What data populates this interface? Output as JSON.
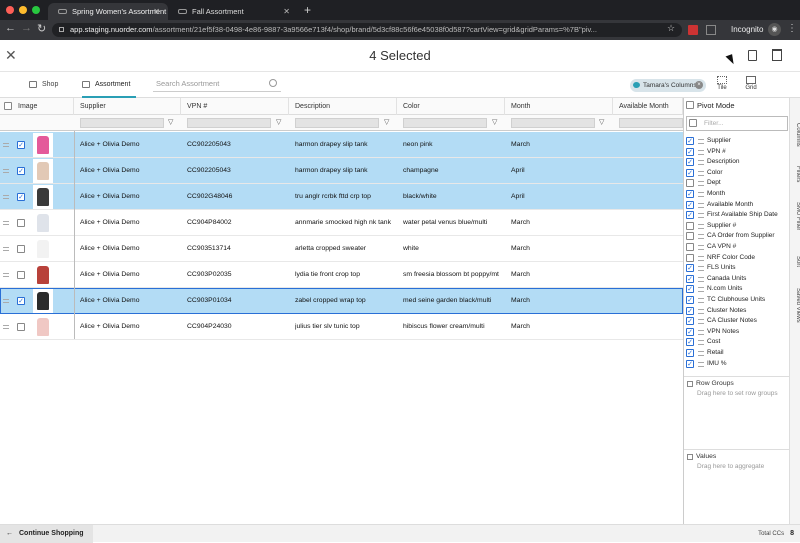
{
  "browser": {
    "tabs": [
      {
        "label": "Spring Women's Assortment",
        "close": "✕"
      },
      {
        "label": "Fall Assortment",
        "close": "✕"
      }
    ],
    "new_tab": "+",
    "url_host": "app.staging.nuorder.com",
    "url_path": "/assortment/21ef5f38-0498-4e86-9887-3a9566e713f4/shop/brand/5d3cf88c56f6e45038f0d587?cartView=grid&gridParams=%7B\"piv...",
    "incognito_label": "Incognito"
  },
  "header": {
    "close": "✕",
    "title": "4 Selected"
  },
  "toolbar": {
    "shop_label": "Shop",
    "assortment_label": "Assortment",
    "search_placeholder": "Search Assortment",
    "chip_label": "Tamara's Columns",
    "chip_close": "×",
    "tile_label": "Tile",
    "grid_label": "Grid"
  },
  "grid": {
    "columns": [
      "Image",
      "Supplier",
      "VPN #",
      "Description",
      "Color",
      "Month",
      "Available Month"
    ],
    "filter_icon": "▽",
    "check_mark": "✓",
    "rows": [
      {
        "supplier": "Alice + Olivia Demo",
        "vpn": "CC902205043",
        "description": "harmon drapey slip tank",
        "color": "neon pink",
        "month": "March",
        "selected": true,
        "thumb": "#e45a9a"
      },
      {
        "supplier": "Alice + Olivia Demo",
        "vpn": "CC902205043",
        "description": "harmon drapey slip tank",
        "color": "champagne",
        "month": "April",
        "selected": true,
        "thumb": "#e2c9b6"
      },
      {
        "supplier": "Alice + Olivia Demo",
        "vpn": "CC902G48046",
        "description": "tru anglr rcrbk fttd crp top",
        "color": "black/white",
        "month": "April",
        "selected": true,
        "thumb": "#3a3a3a"
      },
      {
        "supplier": "Alice + Olivia Demo",
        "vpn": "CC904P84002",
        "description": "annmarie smocked high nk tank",
        "color": "water petal venus blue/multi",
        "month": "March",
        "selected": false,
        "thumb": "#dfe3ea"
      },
      {
        "supplier": "Alice + Olivia Demo",
        "vpn": "CC903513714",
        "description": "arletta cropped sweater",
        "color": "white",
        "month": "March",
        "selected": false,
        "thumb": "#f2f2f2"
      },
      {
        "supplier": "Alice + Olivia Demo",
        "vpn": "CC903P02035",
        "description": "lydia tie front crop top",
        "color": "sm freesia blossom bt poppy/mt",
        "month": "March",
        "selected": false,
        "thumb": "#b8413a"
      },
      {
        "supplier": "Alice + Olivia Demo",
        "vpn": "CC903P01034",
        "description": "zabel cropped wrap top",
        "color": "med seine garden black/multi",
        "month": "March",
        "selected": true,
        "thumb": "#2b2b2b"
      },
      {
        "supplier": "Alice + Olivia Demo",
        "vpn": "CC904P24030",
        "description": "julius tier slv tunic top",
        "color": "hibiscus flower cream/multi",
        "month": "March",
        "selected": false,
        "thumb": "#f0c8c4"
      }
    ]
  },
  "sidebar": {
    "pivot_mode": "Pivot Mode",
    "filter_placeholder": "Filter...",
    "columns": [
      {
        "label": "Supplier",
        "checked": true
      },
      {
        "label": "VPN #",
        "checked": true
      },
      {
        "label": "Description",
        "checked": true
      },
      {
        "label": "Color",
        "checked": true
      },
      {
        "label": "Dept",
        "checked": false
      },
      {
        "label": "Month",
        "checked": true
      },
      {
        "label": "Available Month",
        "checked": true
      },
      {
        "label": "First Available Ship Date",
        "checked": true
      },
      {
        "label": "Supplier #",
        "checked": false
      },
      {
        "label": "CA Order from Supplier",
        "checked": false
      },
      {
        "label": "CA VPN #",
        "checked": false
      },
      {
        "label": "NRF Color Code",
        "checked": false
      },
      {
        "label": "FLS Units",
        "checked": true
      },
      {
        "label": "Canada Units",
        "checked": true
      },
      {
        "label": "N.com Units",
        "checked": true
      },
      {
        "label": "TC Clubhouse Units",
        "checked": true
      },
      {
        "label": "Cluster Notes",
        "checked": true
      },
      {
        "label": "CA Cluster Notes",
        "checked": true
      },
      {
        "label": "VPN Notes",
        "checked": true
      },
      {
        "label": "Cost",
        "checked": true
      },
      {
        "label": "Retail",
        "checked": true
      },
      {
        "label": "IMU %",
        "checked": true
      }
    ],
    "row_groups_title": "Row Groups",
    "row_groups_hint": "Drag here to set row groups",
    "values_title": "Values",
    "values_hint": "Drag here to aggregate",
    "rail": [
      "Columns",
      "Filters",
      "SMU Filter",
      "Sort",
      "Saved Views"
    ]
  },
  "footer": {
    "continue_label": "Continue Shopping",
    "total_label": "Total CCs",
    "total_value": "8"
  }
}
